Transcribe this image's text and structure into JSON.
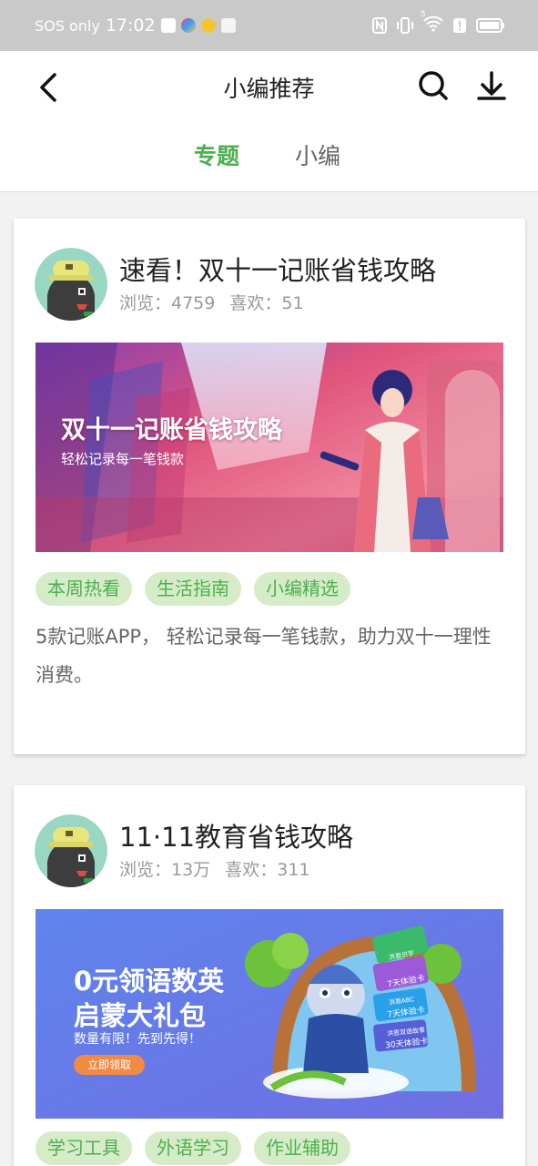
{
  "status_bar": {
    "carrier": "SOS only",
    "time": "17:02",
    "signal": "5"
  },
  "header": {
    "title": "小编推荐",
    "tabs": [
      {
        "label": "专题",
        "active": true
      },
      {
        "label": "小编",
        "active": false
      }
    ]
  },
  "cards": [
    {
      "title": "速看！双十一记账省钱攻略",
      "views_label": "浏览：4759",
      "likes_label": "喜欢：51",
      "banner": {
        "title": "双十一记账省钱攻略",
        "subtitle": "轻松记录每一笔钱款"
      },
      "tags": [
        "本周热看",
        "生活指南",
        "小编精选"
      ],
      "description": "5款记账APP， 轻松记录每一笔钱款，助力双十一理性消费。"
    },
    {
      "title": "11·11教育省钱攻略",
      "views_label": "浏览：13万",
      "likes_label": "喜欢：311",
      "banner": {
        "title_line1": "0元领语数英",
        "title_line2": "启蒙大礼包",
        "subtitle": "数量有限！先到先得！",
        "button": "立即领取",
        "card_labels": [
          "7天体验卡",
          "7天体验卡",
          "30天体验卡"
        ],
        "card_brands": [
          "洪恩识字",
          "洪恩ABC",
          "洪恩双语故事"
        ]
      },
      "tags": [
        "学习工具",
        "外语学习",
        "作业辅助"
      ]
    }
  ],
  "colors": {
    "accent": "#4caf50",
    "tag_bg": "#d6ecc8",
    "status_bar_bg": "#c9c9c9"
  },
  "icons": [
    "back-arrow-icon",
    "search-icon",
    "download-icon",
    "nfc-icon",
    "vibrate-icon",
    "wifi-icon",
    "alert-icon",
    "battery-icon"
  ]
}
